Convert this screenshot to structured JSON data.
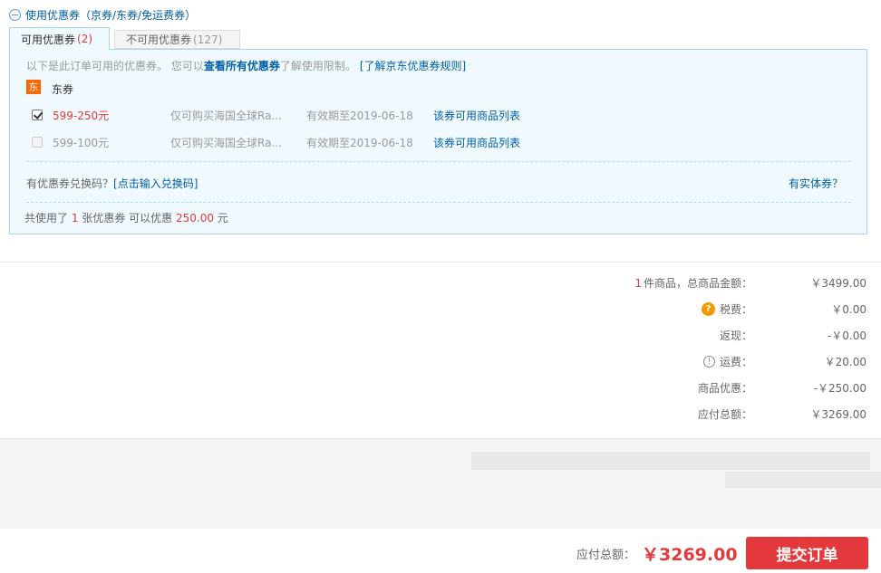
{
  "header": {
    "toggle_label": "使用优惠券（京券/东券/免运费券）"
  },
  "tabs": {
    "available": {
      "label": "可用优惠券",
      "count": "(2)"
    },
    "unavailable": {
      "label": "不可用优惠券",
      "count": "(127)"
    }
  },
  "notice": {
    "prefix": "以下是此订单可用的优惠券。 您可以",
    "view_all_link": "查看所有优惠券",
    "suffix": "了解使用限制。",
    "rules_link": "[了解京东优惠券规则]"
  },
  "group": {
    "badge": "东",
    "title": "东券"
  },
  "coupons": [
    {
      "amount": "599-250元",
      "scope": "仅可购买海国全球Ra...",
      "expiry": "有效期至2019-06-18",
      "link": "该券可用商品列表",
      "checked": true
    },
    {
      "amount": "599-100元",
      "scope": "仅可购买海国全球Ra...",
      "expiry": "有效期至2019-06-18",
      "link": "该券可用商品列表",
      "checked": false
    }
  ],
  "exchange": {
    "text": "有优惠券兑换码？",
    "link": "[点击输入兑换码]"
  },
  "physical_link": "有实体券？",
  "summary": {
    "prefix": "共使用了",
    "count": "1",
    "mid": "张优惠券 可以优惠",
    "amount": "250.00",
    "unit": "元"
  },
  "totals": {
    "items": {
      "count": "1",
      "label": "件商品，总商品金额：",
      "value": "￥3499.00"
    },
    "tax": {
      "icon": "?",
      "label": "税费：",
      "value": "￥0.00"
    },
    "cashback": {
      "label": "返现：",
      "value": "-￥0.00"
    },
    "shipping": {
      "icon": "!",
      "label": "运费：",
      "value": "￥20.00"
    },
    "discount": {
      "label": "商品优惠：",
      "value": "-￥250.00"
    },
    "payable": {
      "label": "应付总额：",
      "value": "￥3269.00"
    }
  },
  "footer": {
    "label": "应付总额：",
    "amount": "￥3269.00",
    "submit": "提交订单"
  },
  "colors": {
    "accent_red": "#e4393c",
    "link_blue": "#005ea7",
    "panel_bg": "#f0fafe",
    "panel_border": "#a9d5ea"
  },
  "icons": {
    "toggle": "minus-circle-icon",
    "tax": "question-circle-icon",
    "shipping": "info-circle-icon"
  }
}
